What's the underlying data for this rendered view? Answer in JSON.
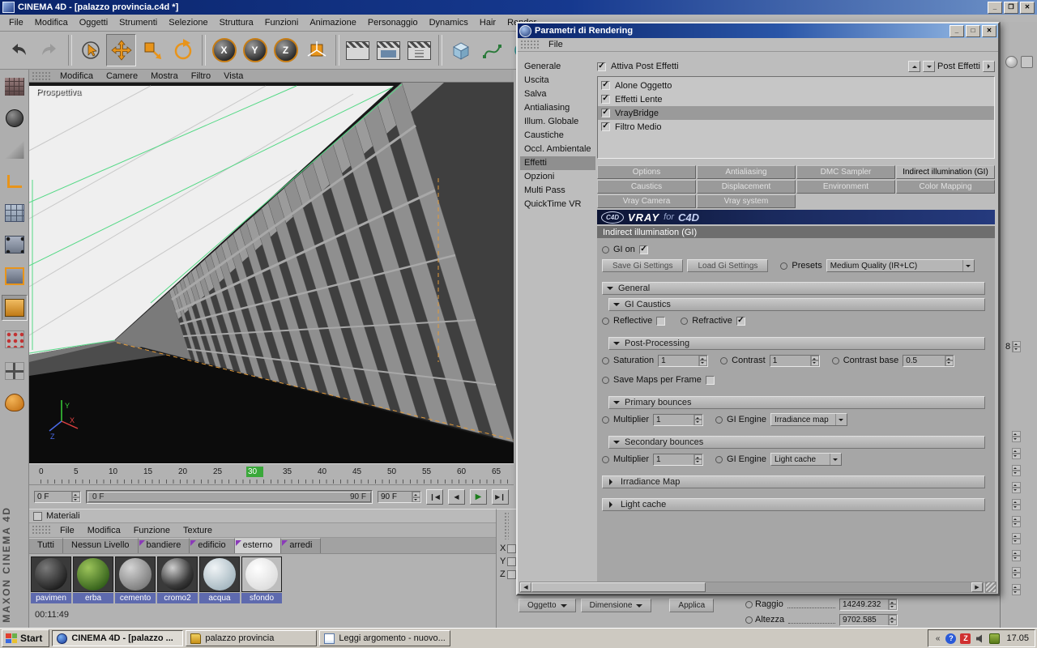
{
  "window": {
    "title": "CINEMA 4D - [palazzo provincia.c4d *]",
    "menus": [
      "File",
      "Modifica",
      "Oggetti",
      "Strumenti",
      "Selezione",
      "Struttura",
      "Funzioni",
      "Animazione",
      "Personaggio",
      "Dynamics",
      "Hair",
      "Render..."
    ],
    "branding": "MAXON CINEMA 4D"
  },
  "toolbar": {
    "axis_x": "X",
    "axis_y": "Y",
    "axis_z": "Z"
  },
  "viewport": {
    "label": "Prospettiva",
    "menus": [
      "Modifica",
      "Camere",
      "Mostra",
      "Filtro",
      "Vista"
    ],
    "axis": {
      "x": "X",
      "y": "Y",
      "z": "Z"
    }
  },
  "timeline": {
    "ticks": [
      "0",
      "5",
      "10",
      "15",
      "20",
      "25",
      "30",
      "35",
      "40",
      "45",
      "50",
      "55",
      "60",
      "65"
    ],
    "start_field": "0 F",
    "range_start": "0 F",
    "range_end": "90 F",
    "end_field": "90 F"
  },
  "materials": {
    "title": "Materiali",
    "menus": [
      "File",
      "Modifica",
      "Funzione",
      "Texture"
    ],
    "tabs": [
      "Tutti",
      "Nessun Livello",
      "bandiere",
      "edificio",
      "esterno",
      "arredi"
    ],
    "items": [
      "pavimen",
      "erba",
      "cemento",
      "cromo2",
      "acqua",
      "sfondo"
    ],
    "timecode": "00:11:49"
  },
  "coords": {
    "x": "X",
    "y": "Y",
    "z": "Z"
  },
  "dialog": {
    "title": "Parametri di Rendering",
    "menu": "File",
    "categories": [
      "Generale",
      "Uscita",
      "Salva",
      "Antialiasing",
      "Illum. Globale",
      "Caustiche",
      "Occl. Ambientale",
      "Effetti",
      "Opzioni",
      "Multi Pass",
      "QuickTime VR"
    ],
    "post": {
      "enable": "Attiva Post Effetti",
      "header": "Post Effetti",
      "items": [
        "Alone Oggetto",
        "Effetti Lente",
        "VrayBridge",
        "Filtro Medio"
      ]
    },
    "vray": {
      "tabs": [
        "Options",
        "Antialiasing",
        "DMC Sampler",
        "Indirect illumination (GI)",
        "Caustics",
        "Displacement",
        "Environment",
        "Color Mapping",
        "Vray Camera",
        "Vray system"
      ],
      "logo_badge": "C4D",
      "logo_vray": "VRAY",
      "logo_for": "for",
      "logo_c4d": "C4D",
      "header": "Indirect illumination (GI)",
      "gi_on": "GI on",
      "save_btn": "Save Gi Settings",
      "load_btn": "Load Gi Settings",
      "presets_label": "Presets",
      "presets_value": "Medium Quality (IR+LC)",
      "general": "General",
      "gi_caustics": "GI Caustics",
      "reflective": "Reflective",
      "refractive": "Refractive",
      "post_processing": "Post-Processing",
      "saturation": "Saturation",
      "saturation_value": "1",
      "contrast": "Contrast",
      "contrast_value": "1",
      "contrast_base": "Contrast base",
      "contrast_base_value": "0.5",
      "save_maps": "Save Maps per Frame",
      "primary": "Primary bounces",
      "secondary": "Secondary bounces",
      "multiplier": "Multiplier",
      "multiplier1_value": "1",
      "multiplier2_value": "1",
      "gi_engine": "GI Engine",
      "engine1_value": "Irradiance map",
      "engine2_value": "Light cache",
      "irradiance_map": "Irradiance Map",
      "light_cache": "Light cache"
    }
  },
  "bottom": {
    "oggetto": "Oggetto",
    "dimensione": "Dimensione",
    "applica": "Applica",
    "raggio": "Raggio",
    "raggio_value": "14249.232",
    "altezza": "Altezza",
    "altezza_value": "9702.585"
  },
  "rightstrip": {
    "eight": "8"
  },
  "taskbar": {
    "start": "Start",
    "tasks": [
      "CINEMA 4D - [palazzo ...",
      "palazzo provincia",
      "Leggi argomento - nuovo..."
    ],
    "clock": "17.05"
  }
}
